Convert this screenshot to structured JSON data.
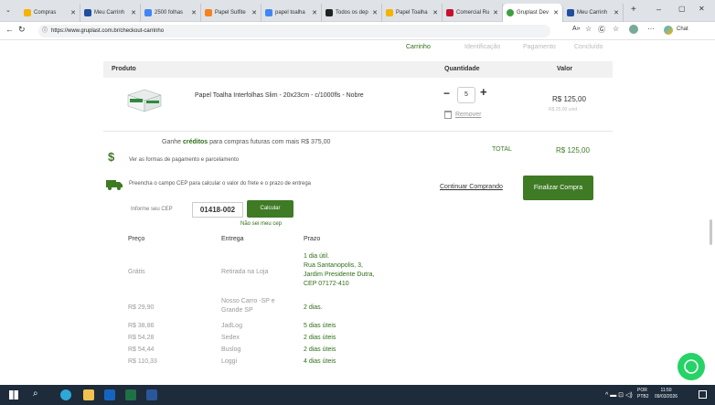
{
  "browser": {
    "tabs": [
      {
        "label": "Compras"
      },
      {
        "label": "Meu Carrinh"
      },
      {
        "label": "2500 folhas"
      },
      {
        "label": "Papel Sulfite"
      },
      {
        "label": "papel toalha"
      },
      {
        "label": "Todos os dep"
      },
      {
        "label": "Papel Toalha"
      },
      {
        "label": "Comercial Ru"
      },
      {
        "label": "Gruplast Dev"
      },
      {
        "label": "Meu Carrinh"
      }
    ],
    "url": "https://www.gruplast.com.br/checkout-carrinho",
    "chat_label": "Chat"
  },
  "checkout": {
    "steps": [
      "Carrinho",
      "Identificação",
      "Pagamento",
      "Concluído"
    ],
    "header": {
      "product": "Produto",
      "quantity": "Quantidade",
      "value": "Valor"
    },
    "product": {
      "name": "Papel Toalha Interfolhas Slim - 20x23cm - c/1000fls - Nobre",
      "quantity": "5",
      "price": "R$ 125,00",
      "unit_price": "R$ 25,00 unid",
      "remove_label": "Remover"
    },
    "credits": {
      "prefix": "Ganhe ",
      "word": "créditos",
      "suffix": " para compras futuras com mais R$ 375,00"
    },
    "total_label": "TOTAL",
    "total_value": "R$ 125,00",
    "payment_link": "Ver as formas de pagamento e parcelamento",
    "freight_text": "Preencha o campo CEP para calcular o valor do frete e o prazo de entrega",
    "continue_label": "Continuar Comprando",
    "finalize_label": "Finalizar Compra",
    "cep_label": "Informe seu CEP",
    "cep_value": "01418-002",
    "calc_label": "Calcular",
    "dont_know_cep": "Não sei meu cep",
    "shipping_headers": {
      "price": "Preço",
      "delivery": "Entrega",
      "deadline": "Prazo"
    },
    "shipping": [
      {
        "price": "Grátis",
        "delivery": "Retirada na Loja",
        "deadline": "1 dia útil.\nRua Santanopolis, 3,\nJardim Presidente Dutra,\nCEP 07172-410"
      },
      {
        "price": "R$ 29,90",
        "delivery": "Nosso Carro -SP e\nGrande SP",
        "deadline": "2 dias."
      },
      {
        "price": "R$ 38,86",
        "delivery": "JadLog",
        "deadline": "5 dias úteis"
      },
      {
        "price": "R$ 54,28",
        "delivery": "Sedex",
        "deadline": "2 dias úteis"
      },
      {
        "price": "R$ 54,44",
        "delivery": "Buslog",
        "deadline": "2 dias úteis"
      },
      {
        "price": "R$ 110,33",
        "delivery": "Loggi",
        "deadline": "4 dias úteis"
      }
    ]
  },
  "taskbar": {
    "lang": "POR",
    "lang2": "PTB2",
    "time": "11:50",
    "date": "09/03/2026"
  },
  "colors": {
    "accent": "#3f7a25",
    "whatsapp": "#25d366"
  }
}
